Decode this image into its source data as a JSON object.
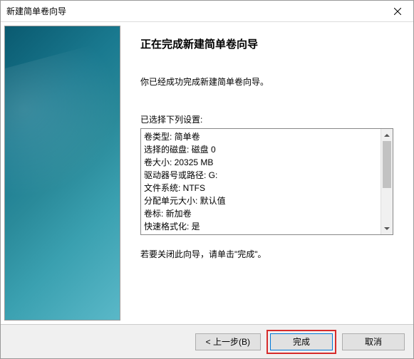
{
  "window": {
    "title": "新建简单卷向导"
  },
  "main": {
    "heading": "正在完成新建简单卷向导",
    "description": "你已经成功完成新建简单卷向导。",
    "settings_label": "已选择下列设置:",
    "settings_lines": [
      "卷类型: 简单卷",
      "选择的磁盘: 磁盘 0",
      "卷大小: 20325 MB",
      "驱动器号或路径: G:",
      "文件系统: NTFS",
      "分配单元大小: 默认值",
      "卷标: 新加卷",
      "快速格式化: 是"
    ],
    "instruction": "若要关闭此向导，请单击\"完成\"。"
  },
  "footer": {
    "back": "< 上一步(B)",
    "finish": "完成",
    "cancel": "取消"
  }
}
